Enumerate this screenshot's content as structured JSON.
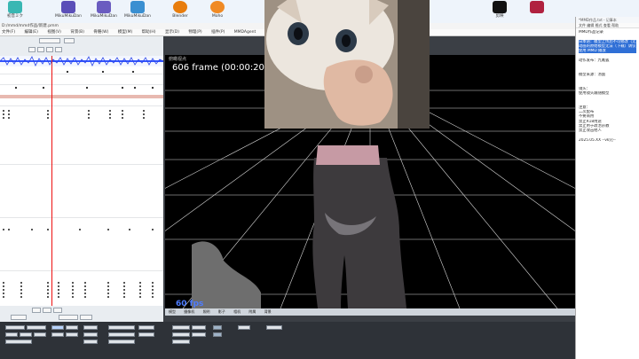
{
  "desktop": {
    "icons": [
      {
        "label": "初音ミク",
        "color": "#39b7b3"
      },
      {
        "label": "MikuMikuDance",
        "color": "#5b4fb8"
      },
      {
        "label": "MikuMikuDance",
        "color": "#6a5cc0"
      },
      {
        "label": "MikuMikuDance",
        "color": "#3a8fd1"
      },
      {
        "label": "Blender",
        "color": "#e87d0d"
      },
      {
        "label": "Moho",
        "color": "#f08a24"
      },
      {
        "label": "剪映",
        "color": "#111111"
      },
      {
        "label": "",
        "color": "#b0213f"
      }
    ]
  },
  "mmd": {
    "title": "D:/mmd/mmd作品/新建.pmm",
    "menu": [
      "文件(F)",
      "编辑(E)",
      "视图(V)",
      "背景(B)",
      "骨骼(W)",
      "模型(M)",
      "帮助(H)",
      "显示(D)",
      "物理(P)",
      "插件(P)",
      "MMDAgent"
    ],
    "frame_readout": "606 frame (00:00:20)",
    "viewport_label": "俯瞰视点",
    "fps": "60 fps",
    "viewport_tabs": [
      "模型",
      "摄像机",
      "照明",
      "影子",
      "相机",
      "附属",
      "背景"
    ]
  },
  "notepad": {
    "title": "*MMD作品.txt - 记事本",
    "menu": [
      "文件",
      "编辑",
      "格式",
      "查看",
      "帮助"
    ],
    "lines": [
      {
        "text": "MMD作品记录",
        "hl": false
      },
      {
        "text": "",
        "hl": false
      },
      {
        "text": "日本语：模型上传后不可修改（无法",
        "hl": true
      },
      {
        "text": "动画的原始模型无法（下载）请仅",
        "hl": true
      },
      {
        "text": "使用 MMD 播放",
        "hl": true
      },
      {
        "text": "",
        "hl": false
      },
      {
        "text": "动作发布：九尾狐",
        "hl": false
      },
      {
        "text": "",
        "hl": false
      },
      {
        "text": "",
        "hl": false
      },
      {
        "text": "模型来源：汤面",
        "hl": false
      },
      {
        "text": "",
        "hl": false
      },
      {
        "text": "",
        "hl": false
      },
      {
        "text": "镜头：",
        "hl": false
      },
      {
        "text": "使用镜头跟随模型",
        "hl": false
      },
      {
        "text": "",
        "hl": false
      },
      {
        "text": "",
        "hl": false
      },
      {
        "text": "注意：",
        "hl": false
      },
      {
        "text": "二次配布",
        "hl": false
      },
      {
        "text": "不要商用",
        "hl": false
      },
      {
        "text": "禁止R18用途",
        "hl": false
      },
      {
        "text": "禁止用于政治宗教",
        "hl": false
      },
      {
        "text": "禁止攻击他人",
        "hl": false
      },
      {
        "text": "",
        "hl": false
      },
      {
        "text": "2025.05.XX   --vk完--",
        "hl": false
      }
    ]
  }
}
